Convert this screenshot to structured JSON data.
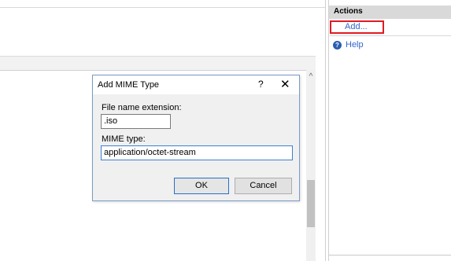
{
  "actions": {
    "title": "Actions",
    "add_label": "Add...",
    "help_label": "Help"
  },
  "dialog": {
    "title": "Add MIME Type",
    "help_glyph": "?",
    "close_glyph": "✕",
    "extension_label": "File name extension:",
    "extension_value": ".iso",
    "mime_label": "MIME type:",
    "mime_value": "application/octet-stream",
    "ok_label": "OK",
    "cancel_label": "Cancel"
  },
  "scrollbar": {
    "up_glyph": "^"
  },
  "colors": {
    "highlight": "#e11b22",
    "link": "#3366cc",
    "dialog_border": "#7a9bc4"
  }
}
